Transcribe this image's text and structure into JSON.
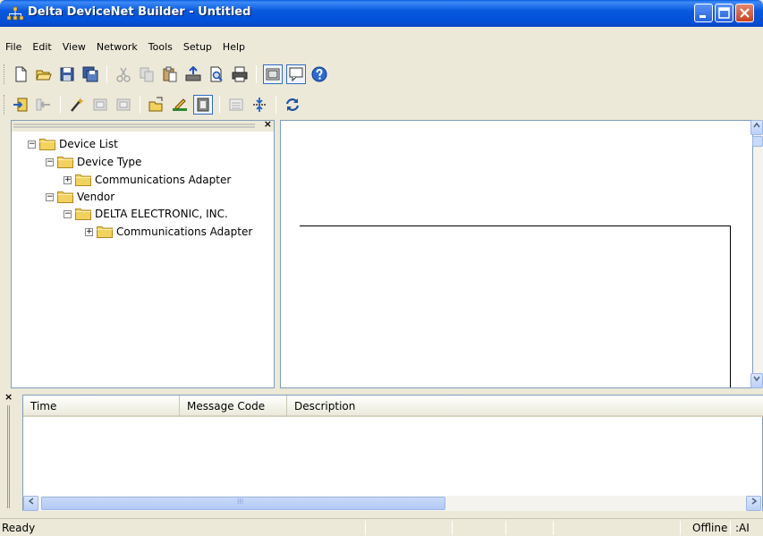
{
  "window": {
    "title": "Delta DeviceNet Builder - Untitled",
    "controls": {
      "minimize": "_",
      "maximize": "□",
      "close": "✕"
    }
  },
  "menu": [
    "File",
    "Edit",
    "View",
    "Network",
    "Tools",
    "Setup",
    "Help"
  ],
  "toolbar1_icons": [
    "new-file-icon",
    "open-folder-icon",
    "save-disk-icon",
    "save-as-icon",
    "cut-icon",
    "copy-icon",
    "paste-icon",
    "upload-icon",
    "print-preview-icon",
    "print-icon",
    "view-panel-icon",
    "message-icon",
    "help-icon"
  ],
  "toolbar2_icons": [
    "import-icon",
    "export-icon",
    "wand-icon",
    "device-in-icon",
    "device-out-icon",
    "scan-icon",
    "pencil-icon",
    "config-icon",
    "list-icon",
    "expand-icon",
    "refresh-icon"
  ],
  "tree": {
    "close": "×",
    "items": [
      {
        "label": "Device List",
        "expander": "−"
      },
      {
        "label": "Device Type",
        "expander": "−"
      },
      {
        "label": "Communications Adapter",
        "expander": "+"
      },
      {
        "label": "Vendor",
        "expander": "−"
      },
      {
        "label": "DELTA ELECTRONIC, INC.",
        "expander": "−"
      },
      {
        "label": "Communications Adapter",
        "expander": "+"
      }
    ]
  },
  "messages": {
    "close": "×",
    "columns": [
      "Time",
      "Message Code",
      "Description"
    ],
    "scroll_grip": "III"
  },
  "status": {
    "left": "Ready",
    "mode": "Offline",
    "right": ":AI"
  },
  "colors": {
    "title_bar": "#0858DE",
    "chrome": "#ECE9D8",
    "folder": "#F2D15F"
  }
}
